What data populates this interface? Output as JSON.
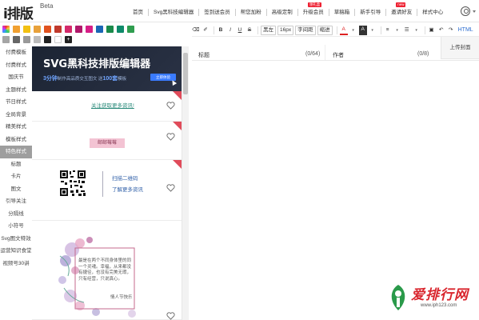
{
  "app": {
    "logo": "i排版",
    "logo_badge": "Beta"
  },
  "nav": [
    {
      "label": "首页"
    },
    {
      "label": "Svg黑科技编辑器"
    },
    {
      "label": "签到送会员"
    },
    {
      "label": "帮您加粉"
    },
    {
      "label": "高级定制"
    },
    {
      "label": "升级会员",
      "tag": "领礼盒"
    },
    {
      "label": "草稿箱"
    },
    {
      "label": "新手引导"
    },
    {
      "label": "邀请好友",
      "tag": "new"
    },
    {
      "label": "样式中心"
    }
  ],
  "swatches": [
    "#444444",
    "#f0a030",
    "#f2c012",
    "#e8a13a",
    "#e0521f",
    "#c0392b",
    "#d42a6a",
    "#b0186a",
    "#d61e86",
    "#1a66b5",
    "#1a8a4a",
    "#0e8a6a",
    "#2f9d4f",
    "#a5a5a5",
    "#666666",
    "#999999",
    "#bbbbbb",
    "#222222",
    "#ffffff"
  ],
  "categories": [
    {
      "label": "付费模板"
    },
    {
      "label": "付费样式"
    },
    {
      "label": "国庆节"
    },
    {
      "label": "主题样式"
    },
    {
      "label": "节日样式"
    },
    {
      "label": "全局背景"
    },
    {
      "label": "精美样式"
    },
    {
      "label": "模板样式"
    },
    {
      "label": "特色样式",
      "active": true
    },
    {
      "label": "标题"
    },
    {
      "label": "卡片"
    },
    {
      "label": "图文"
    },
    {
      "label": "引导关注"
    },
    {
      "label": "分隔线"
    },
    {
      "label": "小符号"
    },
    {
      "label": "Svg图文特效"
    },
    {
      "label": "运营知识食堂"
    },
    {
      "label": "视频号30讲"
    }
  ],
  "banner": {
    "title": "SVG黑科技排版编辑器",
    "sub_highlight1": "3分钟",
    "sub_text": "制作高品质交互图文 送",
    "sub_highlight2": "100套",
    "sub_text2": "模板",
    "button": "立即体验"
  },
  "cards": [
    {
      "link": "关注获取更多资讯!"
    },
    {
      "pink": "邮邮莓莓"
    },
    {
      "qr_line1": "扫描二维码",
      "qr_line2": "了解更多资讯"
    },
    {
      "poem": "最是在两个不同身体里的同一个灵魂。幸福，从来都没有捷径，也没有完美无瑕，只有经营，只说真心。",
      "sign": "情人节快乐"
    }
  ],
  "toolbar": {
    "b": "B",
    "i": "I",
    "u": "U",
    "s": "S",
    "font": "黑左",
    "size": "16px",
    "spacing": "字间距",
    "indent": "缩进",
    "color_a": "A",
    "bg_a": "A",
    "html": "HTML"
  },
  "editor": {
    "title_label": "标题",
    "title_count": "(0/64)",
    "author_label": "作者",
    "author_count": "(0/8)",
    "upload_cover": "上传封面"
  },
  "watermark": {
    "text": "爱排行网",
    "url": "www.iph123.com"
  }
}
